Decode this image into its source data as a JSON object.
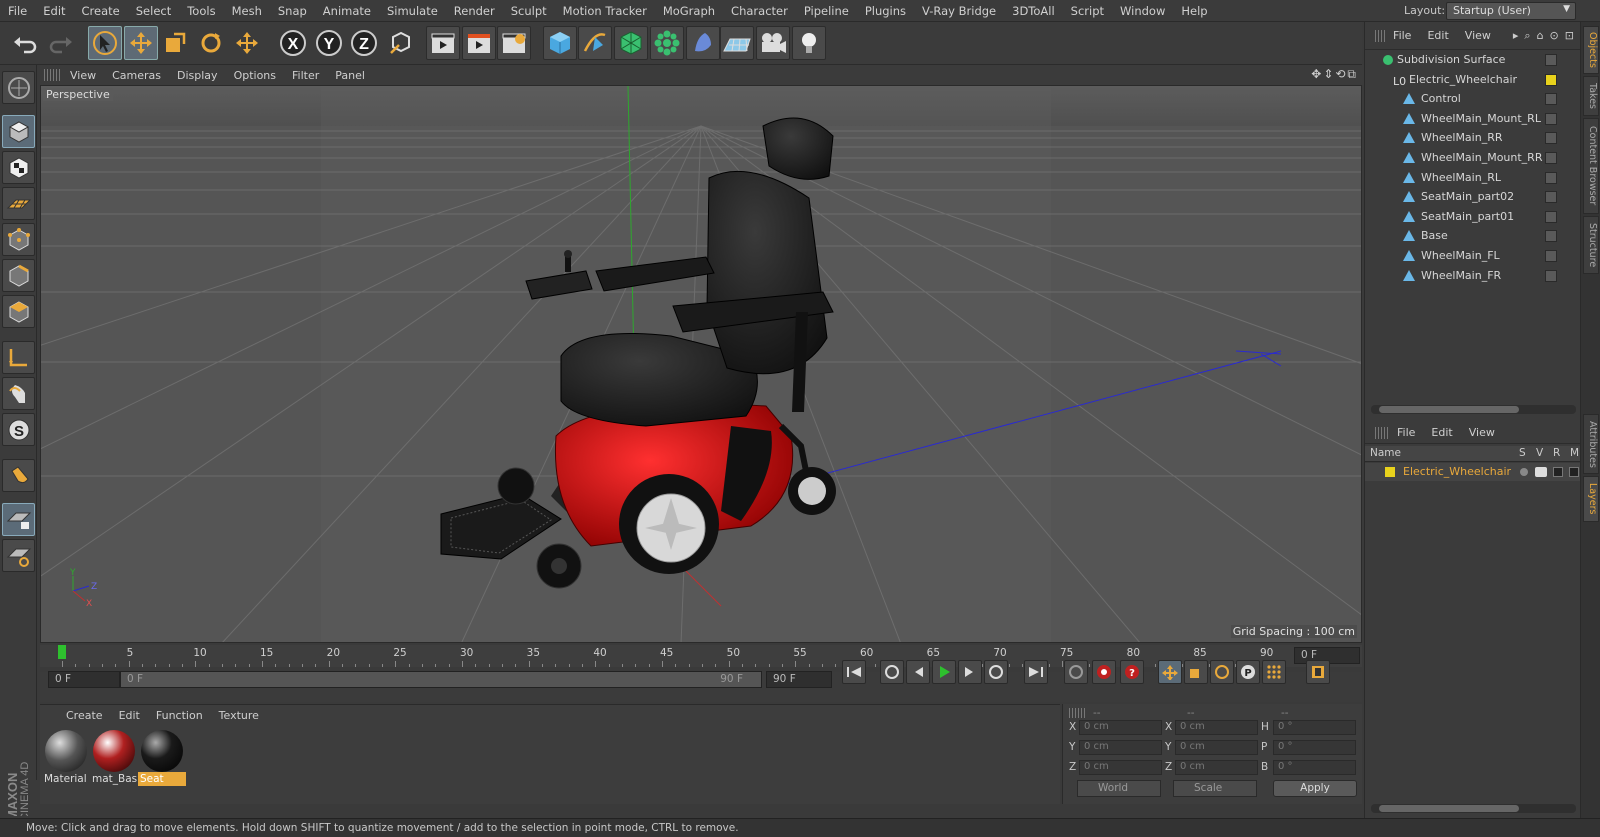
{
  "menubar": {
    "items": [
      "File",
      "Edit",
      "Create",
      "Select",
      "Tools",
      "Mesh",
      "Snap",
      "Animate",
      "Simulate",
      "Render",
      "Sculpt",
      "Motion Tracker",
      "MoGraph",
      "Character",
      "Pipeline",
      "Plugins",
      "V-Ray Bridge",
      "3DToAll",
      "Script",
      "Window",
      "Help"
    ],
    "layout_label": "Layout:",
    "layout_value": "Startup (User)"
  },
  "toolbar": {
    "icons": [
      "undo-icon",
      "redo-icon",
      "select-arrow-icon",
      "move-icon",
      "scale-icon",
      "rotate-icon",
      "transform-icon",
      "x-axis-lock-icon",
      "y-axis-lock-icon",
      "z-axis-lock-icon",
      "coordinate-system-icon",
      "render-view-icon",
      "render-picture-viewer-icon",
      "render-settings-icon",
      "cube-primitive-icon",
      "pen-spline-icon",
      "subdivision-icon",
      "array-icon",
      "deformer-icon",
      "floor-icon",
      "camera-icon",
      "light-icon"
    ],
    "axis_labels": [
      "X",
      "Y",
      "Z"
    ]
  },
  "viewport": {
    "menus": [
      "View",
      "Cameras",
      "Display",
      "Options",
      "Filter",
      "Panel"
    ],
    "name": "Perspective",
    "grid_spacing": "Grid Spacing : 100 cm",
    "axis_labels": [
      "Y",
      "Z",
      "X"
    ]
  },
  "timeline": {
    "ticks": [
      "0",
      "5",
      "10",
      "15",
      "20",
      "25",
      "30",
      "35",
      "40",
      "45",
      "50",
      "55",
      "60",
      "65",
      "70",
      "75",
      "80",
      "85",
      "90"
    ],
    "end_field": "0 F"
  },
  "transport": {
    "current_frame": "0 F",
    "range_start": "0 F",
    "range_end_inner": "90 F",
    "range_end": "90 F"
  },
  "materials": {
    "menus": [
      "Create",
      "Edit",
      "Function",
      "Texture"
    ],
    "items": [
      {
        "name": "Material",
        "selected": false,
        "color": "#6a6a6a"
      },
      {
        "name": "mat_Bas",
        "selected": false,
        "color": "#a82020"
      },
      {
        "name": "Seat",
        "selected": true,
        "color": "#1a1a1a"
      }
    ]
  },
  "coordinates": {
    "header_dashes": [
      "--",
      "--",
      "--"
    ],
    "rows": [
      {
        "l1": "X",
        "v1": "0 cm",
        "l2": "X",
        "v2": "0 cm",
        "l3": "H",
        "v3": "0 °"
      },
      {
        "l1": "Y",
        "v1": "0 cm",
        "l2": "Y",
        "v2": "0 cm",
        "l3": "P",
        "v3": "0 °"
      },
      {
        "l1": "Z",
        "v1": "0 cm",
        "l2": "Z",
        "v2": "0 cm",
        "l3": "B",
        "v3": "0 °"
      }
    ],
    "mode_world": "World",
    "mode_scale": "Scale",
    "apply": "Apply"
  },
  "objects_panel": {
    "menus": [
      "File",
      "Edit",
      "View"
    ],
    "tree": [
      {
        "name": "Subdivision Surface",
        "indent": 0
      },
      {
        "name": "Electric_Wheelchair",
        "indent": 1
      },
      {
        "name": "Control",
        "indent": 2
      },
      {
        "name": "WheelMain_Mount_RL",
        "indent": 2
      },
      {
        "name": "WheelMain_RR",
        "indent": 2
      },
      {
        "name": "WheelMain_Mount_RR",
        "indent": 2
      },
      {
        "name": "WheelMain_RL",
        "indent": 2
      },
      {
        "name": "SeatMain_part02",
        "indent": 2
      },
      {
        "name": "SeatMain_part01",
        "indent": 2
      },
      {
        "name": "Base",
        "indent": 2
      },
      {
        "name": "WheelMain_FL",
        "indent": 2
      },
      {
        "name": "WheelMain_FR",
        "indent": 2
      }
    ]
  },
  "layers_panel": {
    "menus": [
      "File",
      "Edit",
      "View"
    ],
    "columns": [
      "Name",
      "S",
      "V",
      "R",
      "M"
    ],
    "layer_name": "Electric_Wheelchair",
    "layer_color": "#e8d21c"
  },
  "side_tabs": [
    "Objects",
    "Takes",
    "Content Browser",
    "Structure",
    "Attributes",
    "Layers"
  ],
  "status": "Move: Click and drag to move elements. Hold down SHIFT to quantize movement / add to the selection in point mode, CTRL to remove.",
  "brand": {
    "line1": "MAXON",
    "line2": "CINEMA 4D"
  }
}
